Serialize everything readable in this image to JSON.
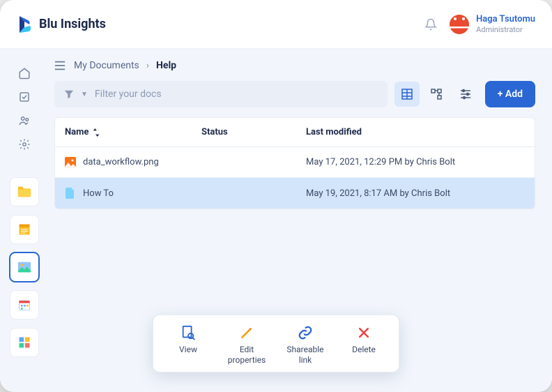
{
  "header": {
    "logo_text": "Blu Insights",
    "user_name": "Haga Tsutomu",
    "user_role": "Administrator"
  },
  "breadcrumb": {
    "parent": "My Documents",
    "current": "Help"
  },
  "filter": {
    "placeholder": "Filter your docs"
  },
  "add_button": "+ Add",
  "columns": {
    "name": "Name",
    "status": "Status",
    "modified": "Last modified"
  },
  "rows": [
    {
      "name": "data_workflow.png",
      "status": "",
      "modified": "May 17, 2021, 12:29 PM by Chris Bolt",
      "icon": "image",
      "selected": false
    },
    {
      "name": "How To",
      "status": "",
      "modified": "May 19, 2021, 8:17 AM by Chris Bolt",
      "icon": "doc",
      "selected": true
    }
  ],
  "actions": {
    "view": "View",
    "edit": "Edit\nproperties",
    "share": "Shareable\nlink",
    "delete": "Delete"
  },
  "sidebar_cards": [
    {
      "name": "folder",
      "active": false
    },
    {
      "name": "notes",
      "active": false
    },
    {
      "name": "gallery",
      "active": true
    },
    {
      "name": "calendar",
      "active": false
    },
    {
      "name": "dashboard",
      "active": false
    }
  ]
}
